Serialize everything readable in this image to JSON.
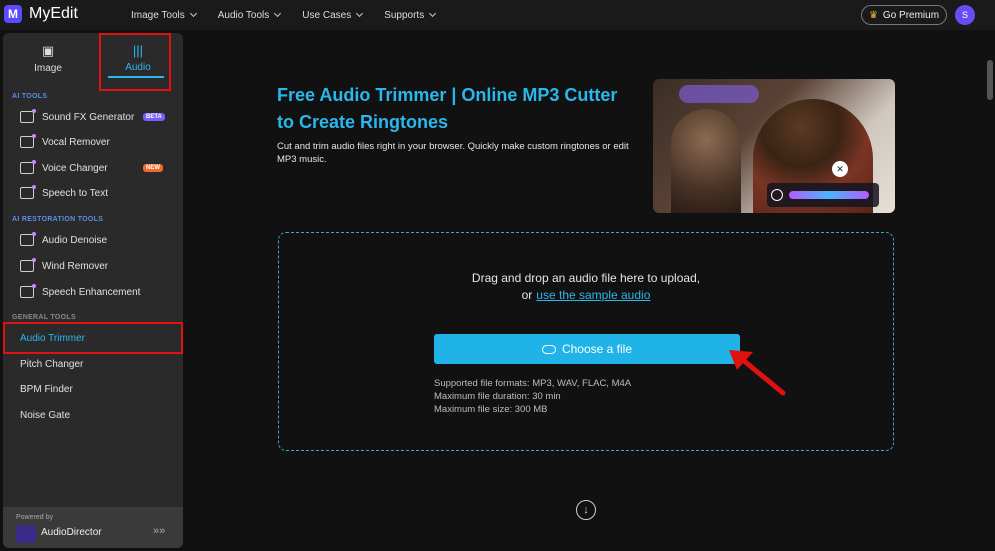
{
  "app": {
    "logo_letter": "M",
    "name": "MyEdit"
  },
  "topnav": {
    "items": [
      "Image Tools",
      "Audio Tools",
      "Use Cases",
      "Supports"
    ],
    "premium_label": "Go Premium",
    "avatar_letter": "S"
  },
  "sidebar": {
    "tabs": [
      {
        "label": "Image",
        "icon": "image-icon"
      },
      {
        "label": "Audio",
        "icon": "audio-wave-icon"
      }
    ],
    "sections": [
      {
        "label": "AI TOOLS"
      },
      {
        "label": "AI RESTORATION TOOLS"
      },
      {
        "label": "GENERAL TOOLS"
      }
    ],
    "ai_tools": [
      {
        "label": "Sound FX Generator",
        "badge": "BETA"
      },
      {
        "label": "Vocal Remover"
      },
      {
        "label": "Voice Changer",
        "badge": "NEW"
      },
      {
        "label": "Speech to Text"
      }
    ],
    "restoration_tools": [
      {
        "label": "Audio Denoise"
      },
      {
        "label": "Wind Remover"
      },
      {
        "label": "Speech Enhancement"
      }
    ],
    "general_tools": [
      {
        "label": "Audio Trimmer"
      },
      {
        "label": "Pitch Changer"
      },
      {
        "label": "BPM Finder"
      },
      {
        "label": "Noise Gate"
      }
    ],
    "powered_by": "Powered by",
    "brand": "AudioDirector"
  },
  "main": {
    "title": "Free Audio Trimmer | Online MP3 Cutter to Create Ringtones",
    "description": "Cut and trim audio files right in your browser. Quickly make custom ringtones or edit MP3 music.",
    "dropzone": {
      "line1": "Drag and drop an audio file here to upload,",
      "line2_prefix": "or",
      "sample_link": "use the sample audio",
      "button": "Choose a file",
      "formats": "Supported file formats: MP3, WAV, FLAC, M4A",
      "duration": "Maximum file duration: 30 min",
      "size": "Maximum file size: 300 MB"
    }
  },
  "colors": {
    "accent": "#29b7ec",
    "button": "#1fb3e8",
    "highlight": "#e01111",
    "brand": "#5b4bff"
  }
}
